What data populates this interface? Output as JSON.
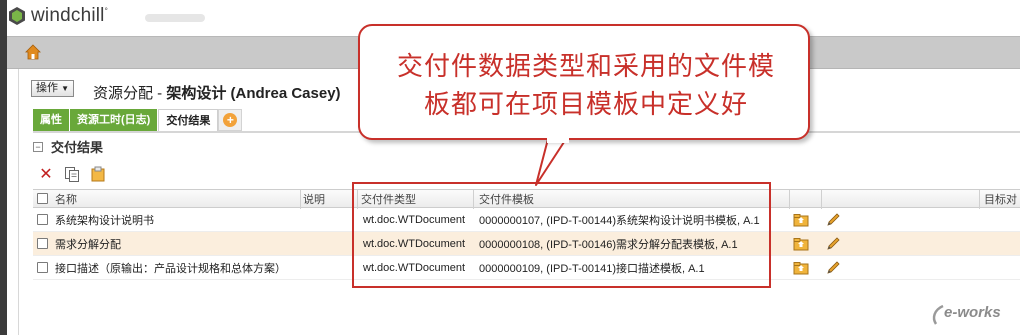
{
  "brand": {
    "name": "windchill",
    "mark": "°"
  },
  "page": {
    "actions_label": "操作",
    "title_prefix": "资源分配 - ",
    "title_strong": "架构设计 (Andrea Casey)"
  },
  "tabs": [
    {
      "label": "属性",
      "active": false
    },
    {
      "label": "资源工时(日志)",
      "active": false
    },
    {
      "label": "交付结果",
      "active": true
    }
  ],
  "section": {
    "title": "交付结果",
    "collapse_glyph": "−"
  },
  "table": {
    "columns": [
      "名称",
      "说明",
      "交付件类型",
      "交付件模板",
      "目标对"
    ],
    "rows": [
      {
        "name": "系统架构设计说明书",
        "type": "wt.doc.WTDocument",
        "template": "0000000107, (IPD-T-00144)系统架构设计说明书模板, A.1"
      },
      {
        "name": "需求分解分配",
        "type": "wt.doc.WTDocument",
        "template": "0000000108, (IPD-T-00146)需求分解分配表模板, A.1"
      },
      {
        "name": "接口描述（原输出：产品设计规格和总体方案）",
        "type": "wt.doc.WTDocument",
        "template": "0000000109, (IPD-T-00141)接口描述模板, A.1"
      }
    ]
  },
  "callout": {
    "line1": "交付件数据类型和采用的文件模",
    "line2": "板都可在项目模板中定义好"
  },
  "watermark": {
    "text": "e-works"
  },
  "colors": {
    "tab_green": "#69a83a",
    "highlight_red": "#c8302a",
    "alt_row": "#fbeedd"
  }
}
